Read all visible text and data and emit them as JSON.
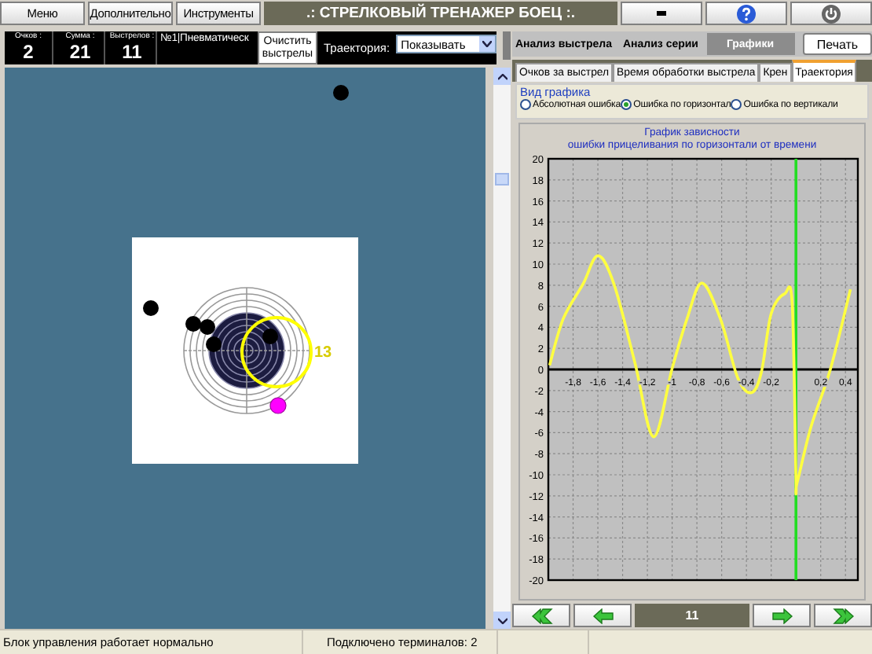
{
  "top_bar": {
    "menu_buttons": [
      "Меню",
      "Дополнительно",
      "Инструменты"
    ],
    "title": ".: СТРЕЛКОВЫЙ ТРЕНАЖЕР БОЕЦ :."
  },
  "info_bar": {
    "stats": [
      {
        "label": "Очков :",
        "value": "2"
      },
      {
        "label": "Сумма :",
        "value": "21"
      },
      {
        "label": "Выстрелов :",
        "value": "11"
      }
    ],
    "weapon": "№1|Пневматическ",
    "clear_button": "Очистить выстрелы",
    "trajectory": {
      "label": "Траектория:",
      "value": "Показывать"
    }
  },
  "target": {
    "score_label": "13"
  },
  "analysis_tabs": [
    {
      "label": "Анализ выстрела",
      "selected": false
    },
    {
      "label": "Анализ серии",
      "selected": false
    },
    {
      "label": "Графики",
      "selected": true
    }
  ],
  "print_button": "Печать",
  "chart_tabs": [
    {
      "label": "Очков за выстрел",
      "selected": false
    },
    {
      "label": "Время обработки выстрела",
      "selected": false
    },
    {
      "label": "Крен",
      "selected": false
    },
    {
      "label": "Траектория",
      "selected": true
    }
  ],
  "chart_type": {
    "title": "Вид графика",
    "options": [
      {
        "label": "Абсолютная ошибка",
        "selected": false
      },
      {
        "label": "Ошибка по горизонтал",
        "selected": true
      },
      {
        "label": "Ошибка по вертикали",
        "selected": false
      }
    ]
  },
  "chart_data": {
    "type": "line",
    "title": "График зависности\nошибки прицеливания по горизонтали от времени",
    "xlim": [
      -2,
      0.5
    ],
    "ylim": [
      -20,
      20
    ],
    "x": [
      -1.99,
      -1.88,
      -1.72,
      -1.6,
      -1.47,
      -1.3,
      -1.15,
      -1.0,
      -0.88,
      -0.76,
      -0.61,
      -0.47,
      -0.36,
      -0.28,
      -0.2,
      -0.09,
      -0.03,
      0.0,
      0.01,
      0.12,
      0.28,
      0.44
    ],
    "series": [
      {
        "color": "#ffff40",
        "values": [
          0.4,
          4.8,
          8.1,
          10.8,
          8.1,
          0.6,
          -6.4,
          0.1,
          4.8,
          8.2,
          4.8,
          -0.8,
          -2.2,
          -0.3,
          5.3,
          7.2,
          6.2,
          -10.2,
          -10.7,
          -5.5,
          0.1,
          7.6
        ]
      }
    ],
    "xticks": [
      {
        "value": -1.8,
        "label": "-1,8"
      },
      {
        "value": -1.6,
        "label": "-1,6"
      },
      {
        "value": -1.4,
        "label": "-1,4"
      },
      {
        "value": -1.2,
        "label": "-1,2"
      },
      {
        "value": -1,
        "label": "-1"
      },
      {
        "value": -0.8,
        "label": "-0,8"
      },
      {
        "value": -0.6,
        "label": "-0,6"
      },
      {
        "value": -0.4,
        "label": "-0,4"
      },
      {
        "value": -0.2,
        "label": "-0,2"
      },
      {
        "value": 0.2,
        "label": "0,2"
      },
      {
        "value": 0.4,
        "label": "0,4"
      }
    ],
    "yticks": [
      20,
      18,
      16,
      14,
      12,
      10,
      8,
      6,
      4,
      2,
      0,
      -2,
      -4,
      -6,
      -8,
      -10,
      -12,
      -14,
      -16,
      -18,
      -20
    ],
    "grid": true,
    "ref_lines": [
      {
        "axis": "x",
        "value": 0,
        "color": "#22dd22"
      }
    ]
  },
  "navigation": {
    "counter": "11"
  },
  "status_bar": [
    "Блок управления работает нормально",
    "Подключено терминалов: 2"
  ]
}
